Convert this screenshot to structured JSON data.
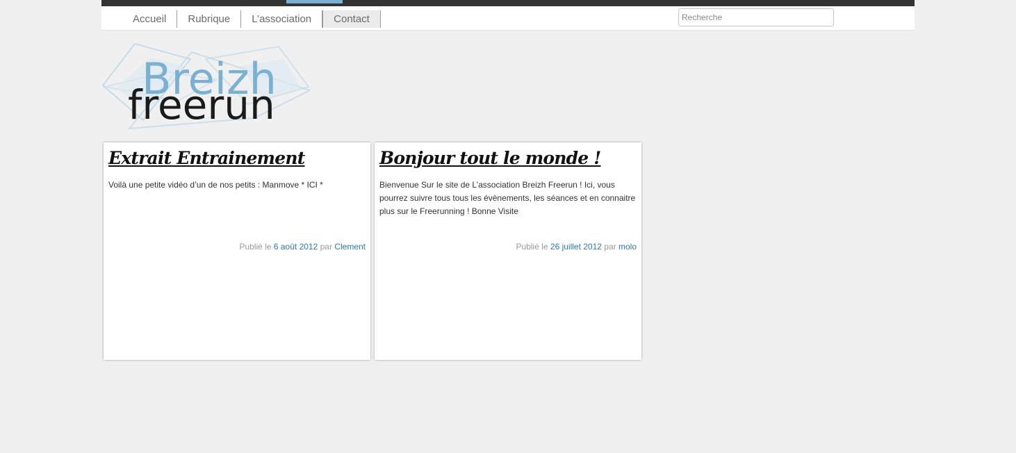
{
  "nav": {
    "items": [
      {
        "label": "Accueil"
      },
      {
        "label": "Rubrique"
      },
      {
        "label": "L’association"
      },
      {
        "label": "Contact"
      }
    ],
    "active_index": 3
  },
  "search": {
    "placeholder": "Recherche",
    "value": ""
  },
  "logo": {
    "line1": "Breizh",
    "line2": "freerun"
  },
  "posts": [
    {
      "title": "Extrait Entrainement",
      "body": "Voilà une petite vidéo d’un de nos petits : Manmove * ICI *",
      "meta_published": "Publié le",
      "date": "6 août 2012",
      "meta_by": "par",
      "author": "Clement"
    },
    {
      "title": "Bonjour tout le monde !",
      "body": "Bienvenue Sur le site de L’association Breizh Freerun ! Ici, vous pourrez suivre tous tous les évènements, les séances et en connaitre plus sur le Freerunning ! Bonne Visite",
      "meta_published": "Publié le",
      "date": "26 juillet 2012",
      "meta_by": "par",
      "author": "molo"
    }
  ],
  "colors": {
    "topbar": "#333333",
    "accent": "#7ab0d2",
    "link": "#2a7ab5",
    "background": "#f0f0f0"
  }
}
